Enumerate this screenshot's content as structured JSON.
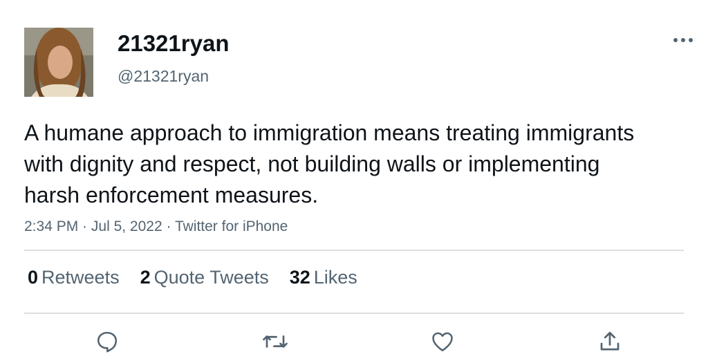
{
  "tweet": {
    "display_name": "21321ryan",
    "handle": "@21321ryan",
    "text": "A humane approach to immigration means treating immigrants with dignity and respect, not building walls or implementing harsh enforcement measures.",
    "time": "2:34 PM",
    "date": "Jul 5, 2022",
    "source": "Twitter for iPhone",
    "separator": " · "
  },
  "stats": {
    "retweets": {
      "count": "0",
      "label": "Retweets"
    },
    "quote_tweets": {
      "count": "2",
      "label": "Quote Tweets"
    },
    "likes": {
      "count": "32",
      "label": "Likes"
    }
  },
  "icons": {
    "more": "more-dots-icon",
    "reply": "reply-icon",
    "retweet": "retweet-icon",
    "like": "like-heart-icon",
    "share": "share-icon"
  },
  "colors": {
    "text_primary": "#0f1419",
    "text_secondary": "#536471",
    "divider": "#dcdfe2"
  }
}
